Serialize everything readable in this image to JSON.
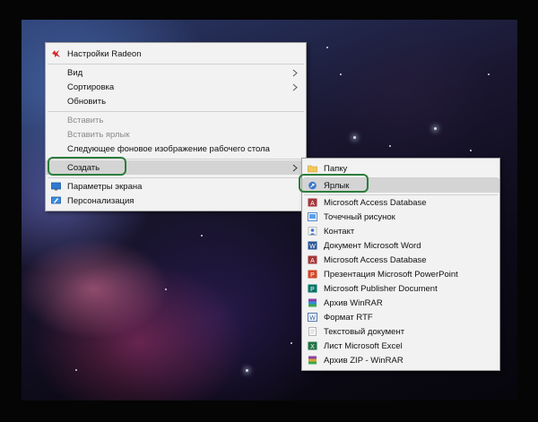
{
  "context_menu": {
    "radeon": "Настройки Radeon",
    "view": "Вид",
    "sort": "Сортировка",
    "refresh": "Обновить",
    "paste": "Вставить",
    "paste_shortcut": "Вставить ярлык",
    "next_background": "Следующее фоновое изображение рабочего стола",
    "create": "Создать",
    "display_settings": "Параметры экрана",
    "personalize": "Персонализация"
  },
  "create_submenu": {
    "items": [
      "Папку",
      "Ярлык",
      "Microsoft Access Database",
      "Точечный рисунок",
      "Контакт",
      "Документ Microsoft Word",
      "Microsoft Access Database",
      "Презентация Microsoft PowerPoint",
      "Microsoft Publisher Document",
      "Архив WinRAR",
      "Формат RTF",
      "Текстовый документ",
      "Лист Microsoft Excel",
      "Архив ZIP - WinRAR"
    ]
  },
  "colors": {
    "highlight_border": "#2d7d3c",
    "radeon_red": "#d6262b",
    "menu_bg": "#f2f2f2",
    "active_bg": "#d4d4d4"
  },
  "icons": {
    "radeon": "radeon-icon",
    "folder": "folder-icon",
    "shortcut": "shortcut-icon",
    "access": "access-icon",
    "bitmap": "bitmap-icon",
    "contact": "contact-icon",
    "word": "word-icon",
    "powerpoint": "powerpoint-icon",
    "publisher": "publisher-icon",
    "winrar": "winrar-icon",
    "rtf": "rtf-icon",
    "text": "text-document-icon",
    "excel": "excel-icon",
    "zip": "zip-icon",
    "display": "display-icon",
    "personalize": "personalize-icon"
  }
}
